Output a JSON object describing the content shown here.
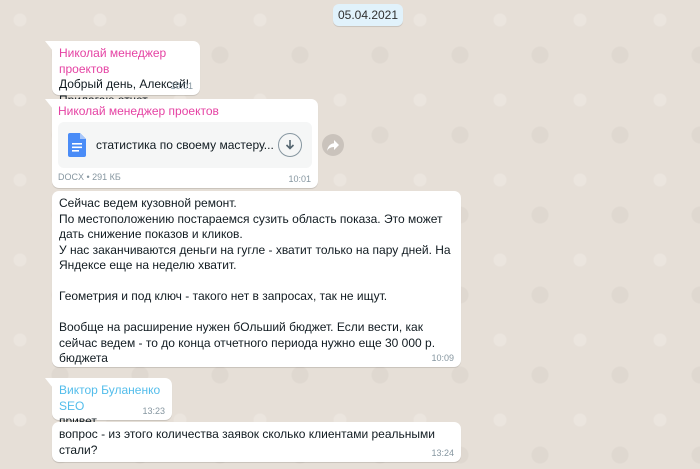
{
  "date_chip": "05.04.2021",
  "messages": [
    {
      "sender": "Николай менеджер проектов",
      "sender_color": "#e542a3",
      "text": "Добрый день, Алексей!\nПрилагаю отчет",
      "time": "10:01"
    },
    {
      "sender": "Николай менеджер проектов",
      "sender_color": "#e542a3",
      "document": {
        "icon": "google-docs-icon",
        "name": "статистика по своему мастеру...",
        "meta": "DOCX • 291 КБ"
      },
      "time": "10:01"
    },
    {
      "text": "Сейчас ведем кузовной ремонт.\nПо местоположению постараемся сузить область показа. Это может дать снижение показов и кликов.\nУ нас заканчиваются деньги на гугле - хватит только на пару дней. На Яндексе еще на неделю хватит.\n\nГеометрия и под ключ - такого нет в запросах, так не ищут.\n\nВообще на расширение нужен бОльший бюджет. Если вести, как сейчас ведем - то до конца отчетного периода нужно еще 30 000 р. бюджета",
      "time": "10:09"
    },
    {
      "sender": "Виктор Буланенко SEO",
      "sender_color": "#53bdeb",
      "text": "привет",
      "time": "13:23"
    },
    {
      "text": "вопрос - из этого количества заявок сколько клиентами реальными стали?",
      "time": "13:24"
    }
  ],
  "colors": {
    "background": "#e6dfd7",
    "bubble": "#ffffff",
    "doc_icon": "#4a8cf7"
  }
}
